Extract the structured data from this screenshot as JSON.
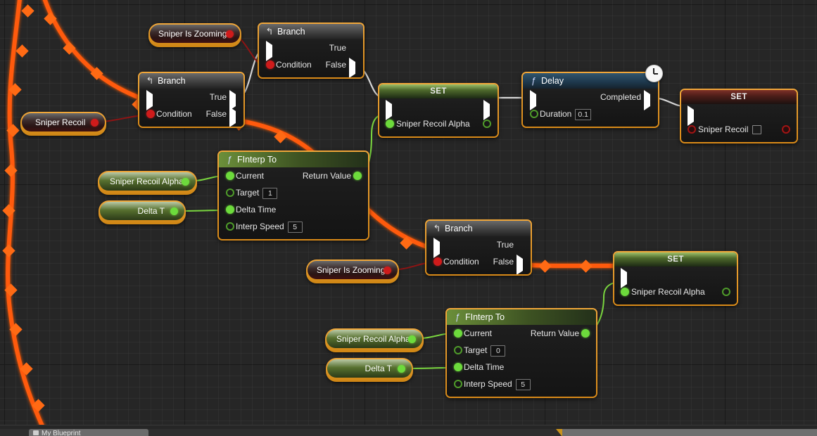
{
  "app": {
    "canvas_background": "#262626",
    "node_border_color": "#e0971f",
    "exec_wire_color": "#ff5500",
    "bool_wire_color": "#8f1414",
    "float_wire_color": "#7ad63f"
  },
  "nodes": {
    "branch_top": {
      "title": "Branch",
      "icon": "branch-c-icon",
      "inputs": [
        {
          "label": "",
          "pin": "exec-in"
        },
        {
          "label": "Condition",
          "pin": "bool-in"
        }
      ],
      "outputs": [
        {
          "label": "True",
          "pin": "exec-out"
        },
        {
          "label": "False",
          "pin": "exec-out"
        }
      ]
    },
    "branch_left": {
      "title": "Branch",
      "icon": "branch-c-icon",
      "inputs": [
        {
          "label": "",
          "pin": "exec-in"
        },
        {
          "label": "Condition",
          "pin": "bool-in"
        }
      ],
      "outputs": [
        {
          "label": "True",
          "pin": "exec-out"
        },
        {
          "label": "False",
          "pin": "exec-out"
        }
      ]
    },
    "branch_mid": {
      "title": "Branch",
      "icon": "branch-c-icon",
      "inputs": [
        {
          "label": "",
          "pin": "exec-in"
        },
        {
          "label": "Condition",
          "pin": "bool-in"
        }
      ],
      "outputs": [
        {
          "label": "True",
          "pin": "exec-out"
        },
        {
          "label": "False",
          "pin": "exec-out"
        }
      ]
    },
    "set_alpha_top": {
      "title": "SET",
      "variable": "Sniper Recoil Alpha",
      "kind": "float"
    },
    "delay": {
      "title": "Delay",
      "icon": "function-f-icon",
      "badge": "clock-icon",
      "output_exec_label": "Completed",
      "duration_label": "Duration",
      "duration_value": "0.1"
    },
    "set_recoil": {
      "title": "SET",
      "variable": "Sniper Recoil",
      "kind": "bool",
      "checkbox_checked": false
    },
    "set_alpha_bottom": {
      "title": "SET",
      "variable": "Sniper Recoil Alpha",
      "kind": "float"
    },
    "finterp_top": {
      "title": "FInterp To",
      "icon": "function-f-icon",
      "inputs": [
        {
          "label": "Current",
          "pin": "float-in-connected"
        },
        {
          "label": "Target",
          "pin": "float-in",
          "value": "1"
        },
        {
          "label": "Delta Time",
          "pin": "float-in-connected"
        },
        {
          "label": "Interp Speed",
          "pin": "float-in",
          "value": "5"
        }
      ],
      "outputs": [
        {
          "label": "Return Value",
          "pin": "float-out"
        }
      ]
    },
    "finterp_bottom": {
      "title": "FInterp To",
      "icon": "function-f-icon",
      "inputs": [
        {
          "label": "Current",
          "pin": "float-in-connected"
        },
        {
          "label": "Target",
          "pin": "float-in",
          "value": "0"
        },
        {
          "label": "Delta Time",
          "pin": "float-in-connected"
        },
        {
          "label": "Interp Speed",
          "pin": "float-in",
          "value": "5"
        }
      ],
      "outputs": [
        {
          "label": "Return Value",
          "pin": "float-out"
        }
      ]
    }
  },
  "variables": {
    "sniper_is_zooming_top": {
      "label": "Sniper Is Zooming",
      "type": "bool"
    },
    "sniper_is_zooming_mid": {
      "label": "Sniper Is Zooming",
      "type": "bool"
    },
    "sniper_recoil": {
      "label": "Sniper Recoil",
      "type": "bool"
    },
    "sniper_recoil_alpha_top": {
      "label": "Sniper Recoil Alpha",
      "type": "float"
    },
    "delta_t_top": {
      "label": "Delta T",
      "type": "float"
    },
    "sniper_recoil_alpha_bottom": {
      "label": "Sniper Recoil Alpha",
      "type": "float"
    },
    "delta_t_bottom": {
      "label": "Delta T",
      "type": "float"
    }
  },
  "bottom_bar": {
    "tab_label": "My Blueprint"
  }
}
